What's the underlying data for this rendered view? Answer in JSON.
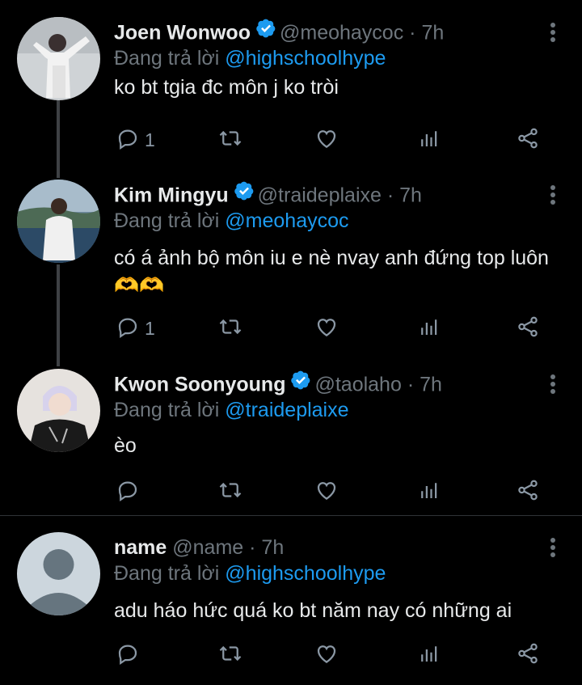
{
  "tweets": [
    {
      "name": "Joen Wonwoo",
      "verified": true,
      "handle": "@meohaycoc",
      "time": "· 7h",
      "reply_prefix": "Đang trả lời ",
      "reply_to": "@highschoolhype",
      "text": "ko bt tgia đc môn j ko tròi",
      "reply_count": "1"
    },
    {
      "name": "Kim Mingyu",
      "verified": true,
      "handle": "@traideplaixe",
      "time": "· 7h",
      "reply_prefix": "Đang trả lời ",
      "reply_to": "@meohaycoc",
      "text": "có á ảnh bộ môn iu e nè nvay anh đứng top luôn🫶🫶",
      "reply_count": "1"
    },
    {
      "name": "Kwon Soonyoung",
      "verified": true,
      "handle": "@taolaho",
      "time": "· 7h",
      "reply_prefix": "Đang trả lời ",
      "reply_to": "@traideplaixe",
      "text": "èo",
      "reply_count": ""
    },
    {
      "name": "name",
      "verified": false,
      "handle": "@name",
      "time": "· 7h",
      "reply_prefix": "Đang trả lời ",
      "reply_to": "@highschoolhype",
      "text": "adu háo hức quá ko bt năm nay có những ai",
      "reply_count": ""
    }
  ],
  "icons": {
    "reply": "reply-icon",
    "retweet": "retweet-icon",
    "like": "heart-icon",
    "views": "analytics-icon",
    "share": "share-icon",
    "more": "more-vertical-icon",
    "verified": "verified-badge-icon"
  },
  "colors": {
    "background": "#000000",
    "link": "#1d9bf0",
    "muted": "#6e767d",
    "icon": "#8b98a5",
    "thread_line": "#3e4144"
  }
}
